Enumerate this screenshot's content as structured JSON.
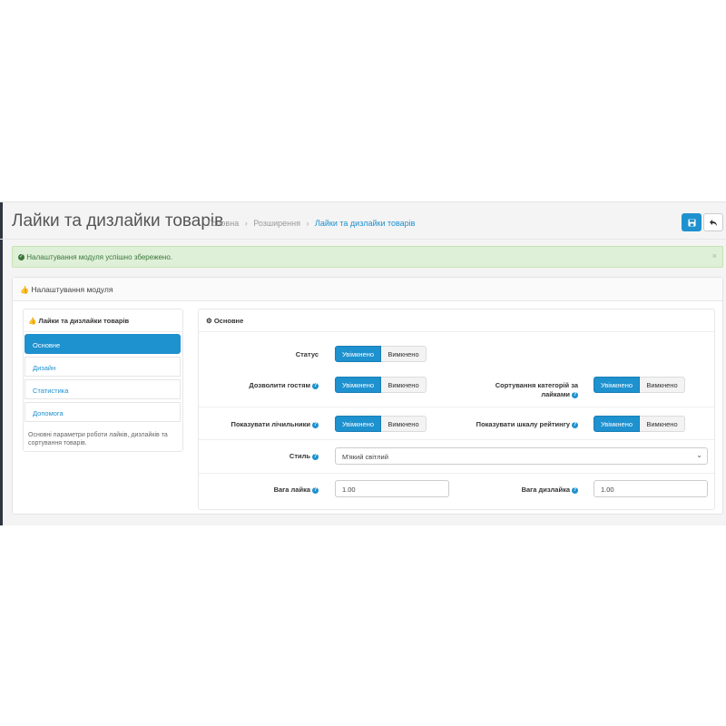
{
  "header": {
    "title": "Лайки та дизлайки товарів",
    "breadcrumb": [
      "Головна",
      "Розширення",
      "Лайки та дизлайки товарів"
    ],
    "save_icon": "save-icon",
    "back_icon": "reply-icon"
  },
  "alert": {
    "text": "Налаштування модуля успішно збережено.",
    "close": "×",
    "icon": "check-circle-icon"
  },
  "panel": {
    "title": "Налаштування модуля",
    "icon": "thumbs-up-icon"
  },
  "sidebar": {
    "title": "Лайки та дизлайки товарів",
    "items": [
      {
        "label": "Основне",
        "active": true
      },
      {
        "label": "Дизайн",
        "active": false
      },
      {
        "label": "Статистика",
        "active": false
      },
      {
        "label": "Допомога",
        "active": false
      }
    ],
    "description": "Основні параметри роботи лайків, дизлайків та сортування товарів."
  },
  "main": {
    "title": "Основне",
    "icon": "cogs-icon",
    "on_label": "Увімкнено",
    "off_label": "Вимкнено",
    "help": "?",
    "fields": {
      "status": "Статус",
      "allow_guests": "Дозволити гостям",
      "sort_categories_line1": "Сортування категорій за",
      "sort_categories_line2": "лайками",
      "show_counters": "Показувати лічильники",
      "show_rating_scale": "Показувати шкалу рейтингу",
      "style": "Стиль",
      "style_value": "М'який світлий",
      "like_weight": "Вага лайка",
      "like_weight_value": "1.00",
      "dislike_weight": "Вага дизлайка",
      "dislike_weight_value": "1.00"
    }
  },
  "colors": {
    "primary": "#1e91cf",
    "success_bg": "#dff0d8",
    "success_text": "#3c763d"
  }
}
